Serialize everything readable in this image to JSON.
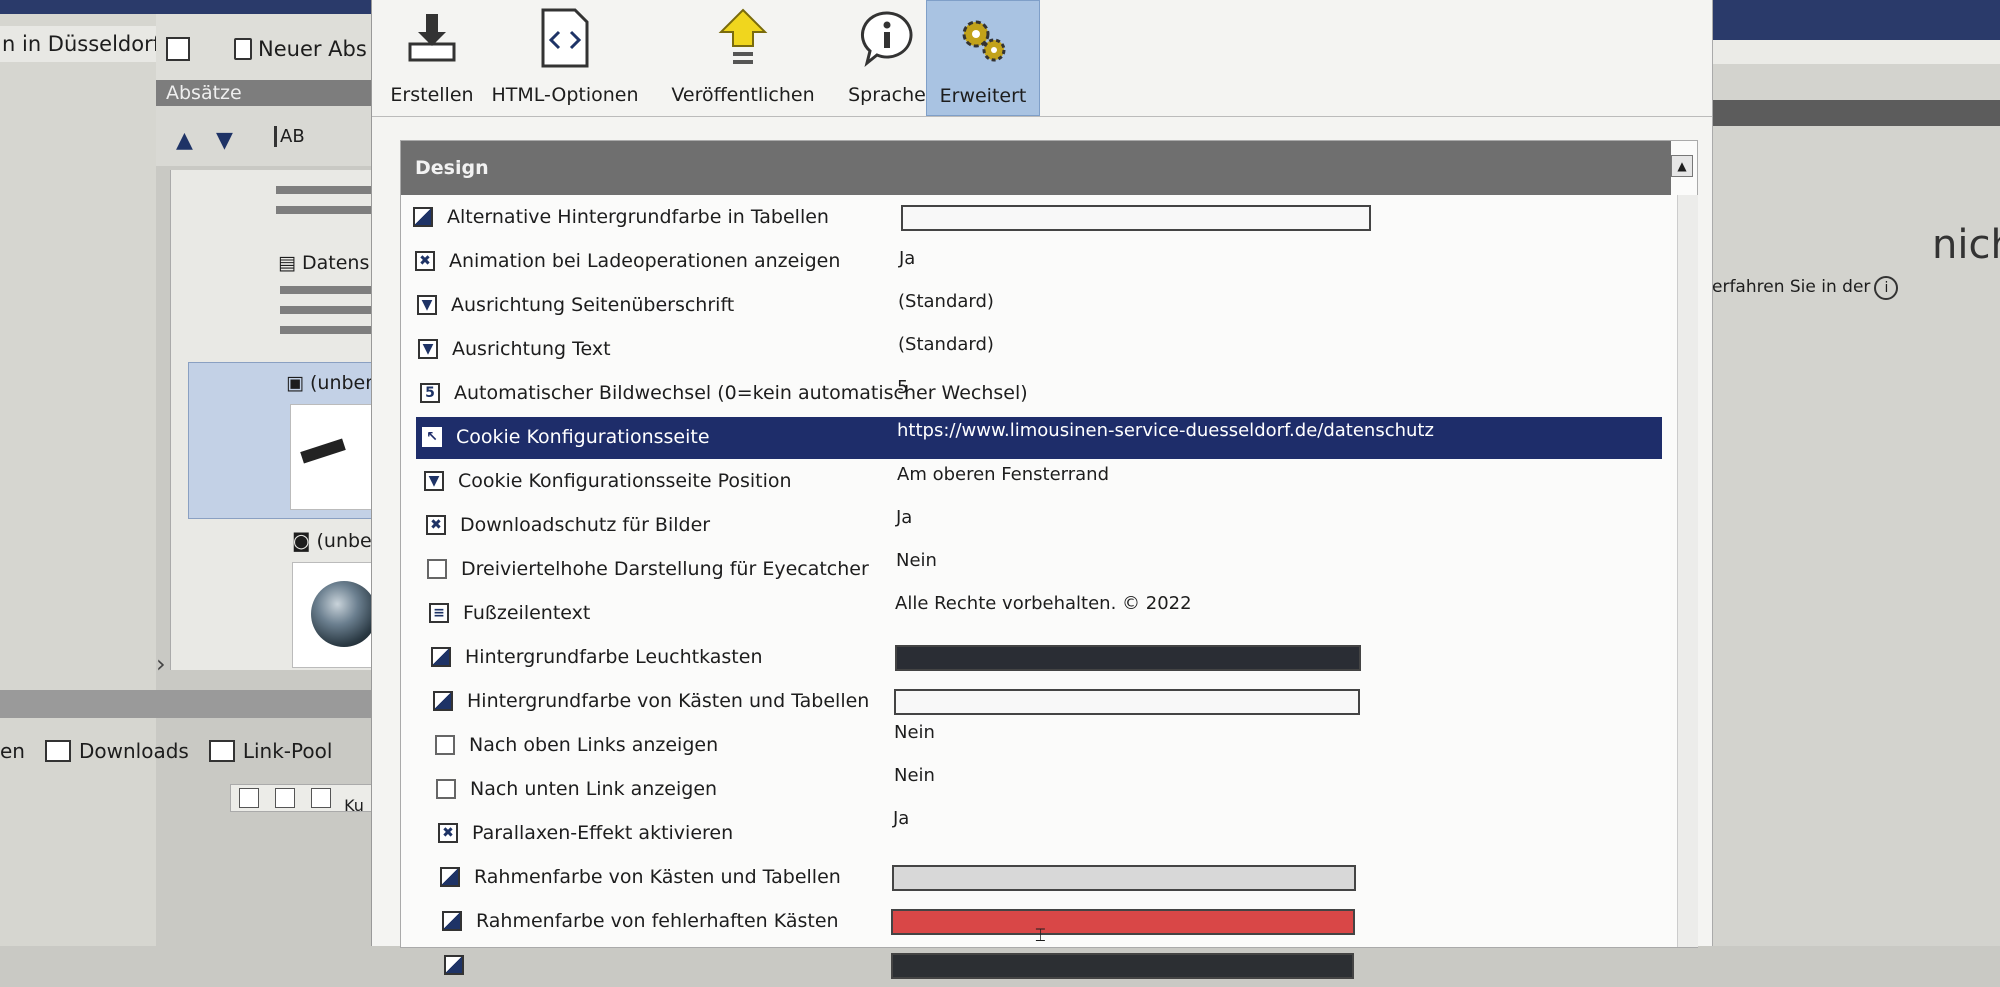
{
  "background": {
    "window_title": "n in Düsseldorf",
    "new_paragraph_button": "Neuer Abs",
    "paragraphs_panel_title": "Absätze",
    "text_tool_label": "AB",
    "list_items": [
      "Datens",
      "(unbena",
      "(unbena"
    ],
    "bottom_tabs": [
      "en",
      "Downloads",
      "Link-Pool"
    ],
    "bottom_partial_label": "Ku",
    "right_fragment_text": "nich",
    "right_hint_text": "erfahren Sie in der",
    "info_glyph": "i"
  },
  "ribbon": {
    "tabs": [
      {
        "label": "Erstellen",
        "icon": "download-icon"
      },
      {
        "label": "HTML-Optionen",
        "icon": "html-code-icon"
      },
      {
        "label": "Veröffentlichen",
        "icon": "publish-arrow-icon"
      },
      {
        "label": "Sprache",
        "icon": "info-bubble-icon"
      },
      {
        "label": "Erweitert",
        "icon": "gears-icon",
        "active": true
      }
    ]
  },
  "design": {
    "group_title": "Design",
    "rows": [
      {
        "name": "Alternative Hintergrundfarbe in Tabellen",
        "type": "color",
        "value": "",
        "swatch": "#f8f8f8"
      },
      {
        "name": "Animation bei Ladeoperationen anzeigen",
        "type": "checkbox",
        "value": "Ja",
        "mark": "✖"
      },
      {
        "name": "Ausrichtung Seitenüberschrift",
        "type": "dropdown",
        "value": "(Standard)",
        "mark": "▼"
      },
      {
        "name": "Ausrichtung Text",
        "type": "dropdown",
        "value": "(Standard)",
        "mark": "▼"
      },
      {
        "name": "Automatischer Bildwechsel (0=kein automatischer Wechsel)",
        "type": "number",
        "value": "5",
        "mark": "5"
      },
      {
        "name": "Cookie Konfigurationsseite",
        "type": "link",
        "value": "https://www.limousinen-service-duesseldorf.de/datenschutz",
        "mark": "↖",
        "selected": true
      },
      {
        "name": "Cookie Konfigurationsseite Position",
        "type": "dropdown",
        "value": "Am oberen Fensterrand",
        "mark": "▼"
      },
      {
        "name": "Downloadschutz für Bilder",
        "type": "checkbox",
        "value": "Ja",
        "mark": "✖"
      },
      {
        "name": "Dreiviertelhohe Darstellung für Eyecatcher",
        "type": "checkbox-empty",
        "value": "Nein",
        "mark": ""
      },
      {
        "name": "Fußzeilentext",
        "type": "text",
        "value": "Alle Rechte vorbehalten. © 2022",
        "mark": "≡"
      },
      {
        "name": "Hintergrundfarbe Leuchtkasten",
        "type": "color",
        "value": "",
        "swatch": "#2a2d34"
      },
      {
        "name": "Hintergrundfarbe von Kästen und Tabellen",
        "type": "color",
        "value": "",
        "swatch": "#f8f8f8"
      },
      {
        "name": "Nach oben Links anzeigen",
        "type": "checkbox-empty",
        "value": "Nein",
        "mark": ""
      },
      {
        "name": "Nach unten Link anzeigen",
        "type": "checkbox-empty",
        "value": "Nein",
        "mark": ""
      },
      {
        "name": "Parallaxen-Effekt aktivieren",
        "type": "checkbox",
        "value": "Ja",
        "mark": "✖"
      },
      {
        "name": "Rahmenfarbe von Kästen und Tabellen",
        "type": "color",
        "value": "",
        "swatch": "#d8d8d8"
      },
      {
        "name": "Rahmenfarbe von fehlerhaften Kästen",
        "type": "color",
        "value": "",
        "swatch": "#d94747"
      },
      {
        "name": "",
        "type": "color",
        "value": "",
        "swatch": "#2c2f33"
      }
    ]
  },
  "colors": {
    "selection": "#1e2d6a",
    "active_tab": "#a9c3e2",
    "group_header": "#6f6f6f"
  }
}
